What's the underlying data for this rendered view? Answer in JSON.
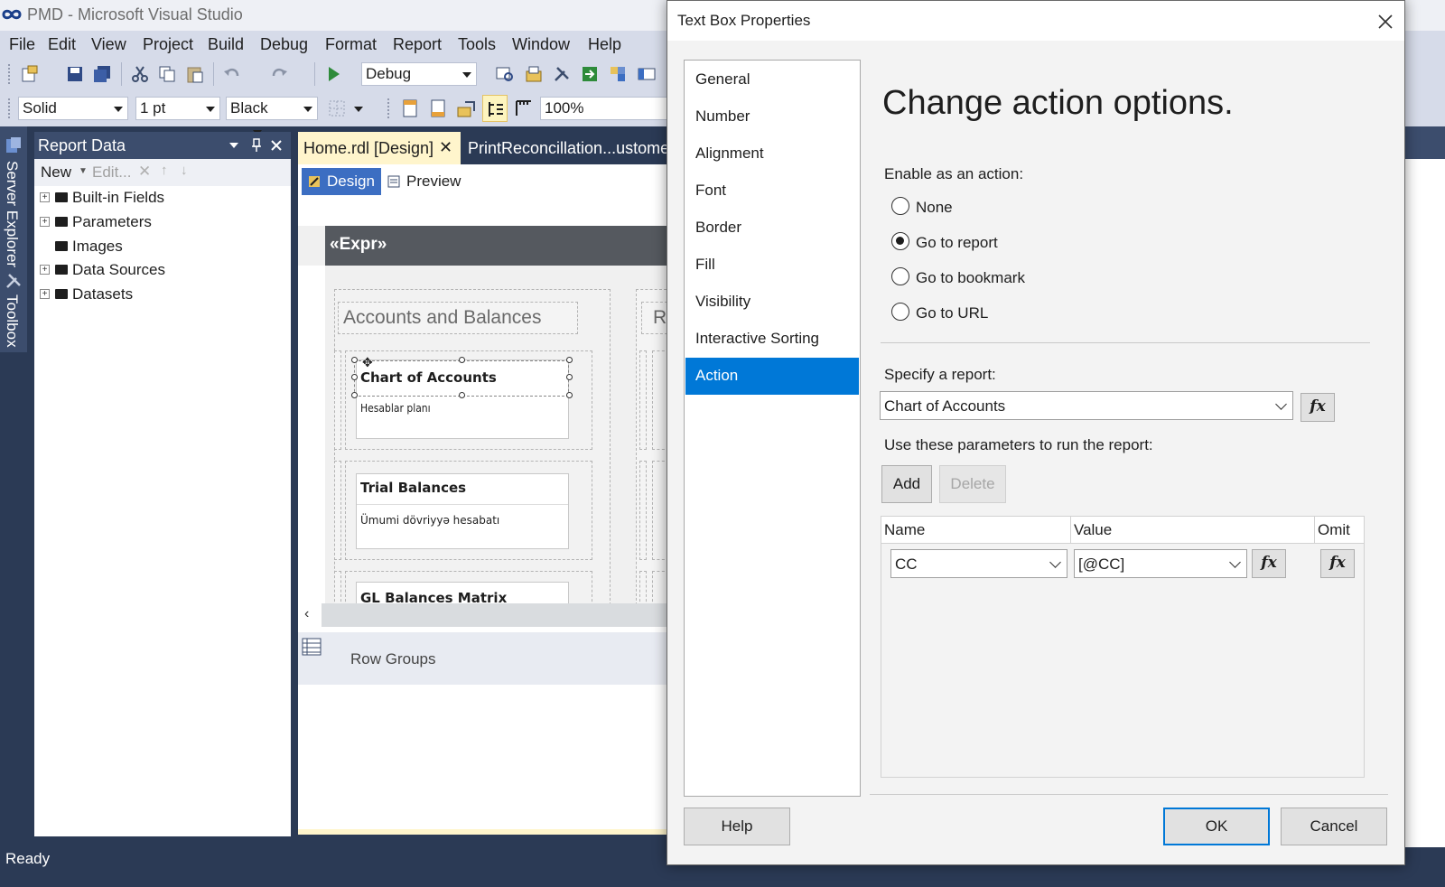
{
  "app": {
    "title": "PMD - Microsoft Visual Studio",
    "status": "Ready"
  },
  "menu": [
    "File",
    "Edit",
    "View",
    "Project",
    "Build",
    "Debug",
    "Format",
    "Report",
    "Tools",
    "Window",
    "Help"
  ],
  "toolbar": {
    "config": "Debug",
    "line_style": "Solid",
    "line_width": "1 pt",
    "line_color": "Black",
    "zoom": "100%"
  },
  "side_strip": {
    "server_explorer": "Server Explorer",
    "toolbox": "Toolbox"
  },
  "report_data": {
    "title": "Report Data",
    "new_label": "New",
    "edit_label": "Edit...",
    "items": [
      {
        "label": "Built-in Fields",
        "expandable": true
      },
      {
        "label": "Parameters",
        "expandable": true
      },
      {
        "label": "Images",
        "expandable": false
      },
      {
        "label": "Data Sources",
        "expandable": true
      },
      {
        "label": "Datasets",
        "expandable": true
      }
    ]
  },
  "doc_tabs": {
    "active": "Home.rdl [Design]",
    "inactive": "PrintReconcillation...ustomer.r"
  },
  "design_bar": {
    "design": "Design",
    "preview": "Preview"
  },
  "canvas": {
    "header_expr": "«Expr»",
    "section_title": "Accounts and Balances",
    "second_section_initial": "R",
    "cards": [
      {
        "title": "Chart of Accounts",
        "subtitle": "Hesablar planı"
      },
      {
        "title": "Trial Balances",
        "subtitle": "Ümumi dövriyyə hesabatı"
      },
      {
        "title": "GL Balances Matrix",
        "subtitle": ""
      }
    ]
  },
  "groups": {
    "row_groups": "Row Groups"
  },
  "dialog": {
    "title": "Text Box Properties",
    "heading": "Change action options.",
    "nav": [
      "General",
      "Number",
      "Alignment",
      "Font",
      "Border",
      "Fill",
      "Visibility",
      "Interactive Sorting",
      "Action"
    ],
    "active_nav": "Action",
    "enable_label": "Enable as an action:",
    "options": [
      {
        "label": "None",
        "checked": false
      },
      {
        "label": "Go to report",
        "checked": true
      },
      {
        "label": "Go to bookmark",
        "checked": false
      },
      {
        "label": "Go to URL",
        "checked": false
      }
    ],
    "specify_label": "Specify a report:",
    "report_value": "Chart of Accounts",
    "params_label": "Use these parameters to run the report:",
    "add": "Add",
    "delete": "Delete",
    "columns": {
      "name": "Name",
      "value": "Value",
      "omit": "Omit"
    },
    "params": [
      {
        "name": "CC",
        "value": "[@CC]"
      }
    ],
    "fx": "fx",
    "help": "Help",
    "ok": "OK",
    "cancel": "Cancel"
  }
}
